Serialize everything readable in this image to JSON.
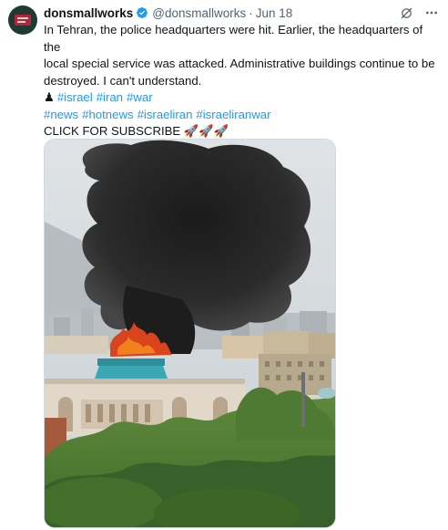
{
  "author": {
    "name": "donsmallworks",
    "handle": "@donsmallworks",
    "separator": "·",
    "date": "Jun 18",
    "verified_color": "#1d9bf0"
  },
  "icons": {
    "verified": "verified-badge-icon",
    "grok": "grok-icon",
    "more": "more-options-icon",
    "chess": "chess-pawn-icon"
  },
  "tweet": {
    "line1": "In Tehran, the police headquarters were hit. Earlier, the headquarters of the",
    "line2": "local special service was attacked. Administrative buildings continue to be",
    "line3": "destroyed. I can't understand.",
    "chess_glyph": "♟",
    "hashtags_row1": [
      "#israel",
      "#iran",
      "#war"
    ],
    "hashtags_row2": [
      "#news",
      "#hotnews",
      "#israeliran",
      "#israeliranwar"
    ],
    "cta": "CLICK FOR SUBSCRIBE",
    "cta_emojis": "🚀🚀🚀"
  },
  "media": {
    "subject": "smoke-over-domed-building-photo",
    "link_color": "#1d9bf0"
  }
}
